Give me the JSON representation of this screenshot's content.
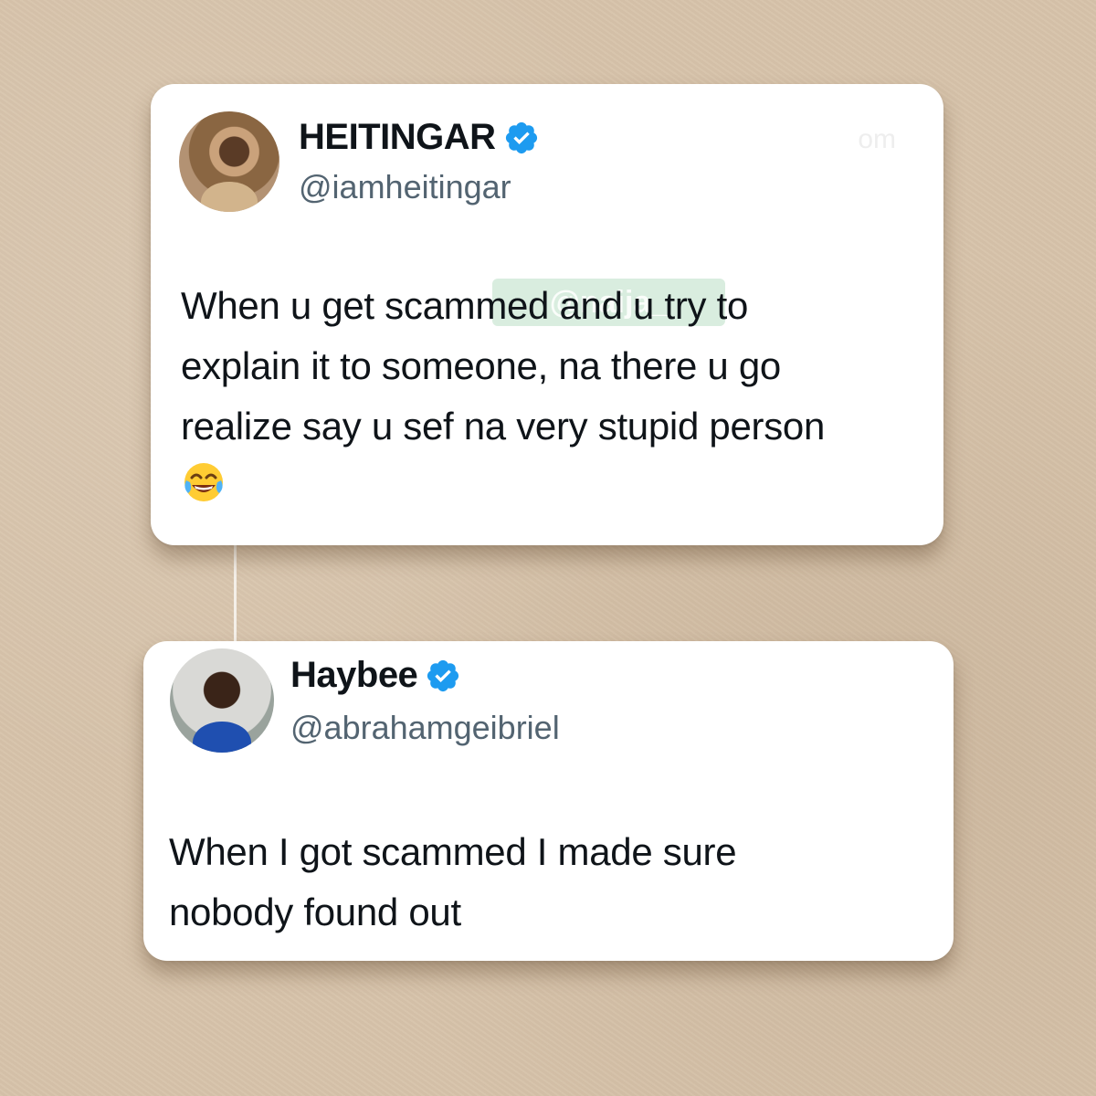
{
  "tweets": [
    {
      "display_name": "HEITINGAR",
      "handle": "@iamheitingar",
      "verified": true,
      "text": "When u get scammed and u try to\nexplain it to someone, na there u go\nrealize say u sef na very stupid person",
      "emoji": "face-with-tears-of-joy",
      "corner_mark": "om"
    },
    {
      "display_name": "Haybee",
      "handle": "@abrahamgeibriel",
      "verified": true,
      "text": "When I got scammed I made sure\nnobody found out"
    }
  ],
  "watermark": "@naija_"
}
